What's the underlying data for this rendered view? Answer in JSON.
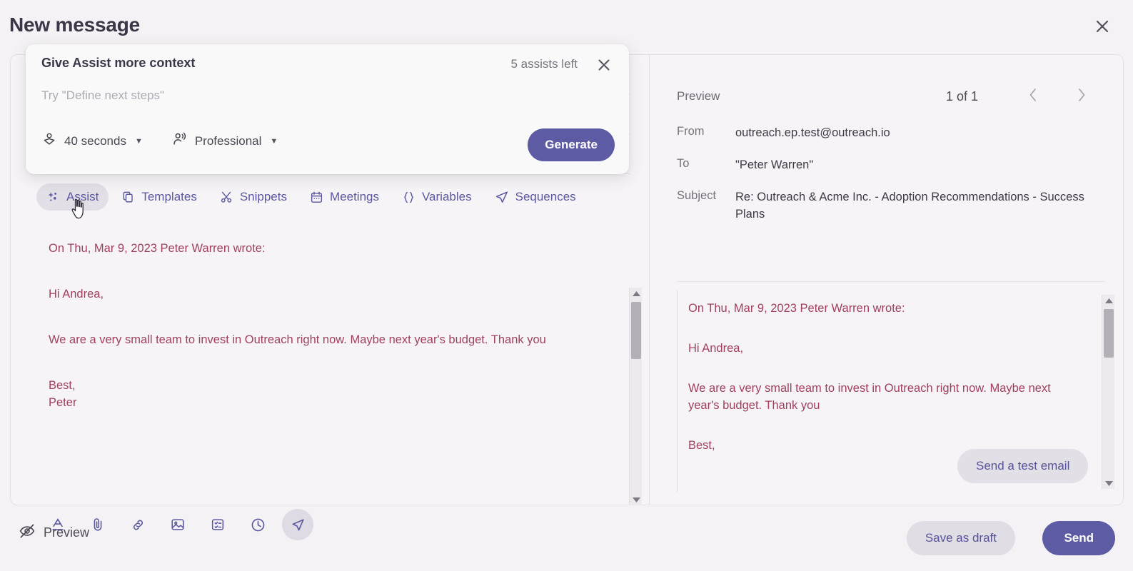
{
  "header": {
    "title": "New message",
    "close_icon": "close-icon"
  },
  "assist_popup": {
    "title": "Give Assist more context",
    "assists_left": "5 assists left",
    "close_icon": "close-icon",
    "input_placeholder": "Try \"Define next steps\"",
    "input_value": "",
    "duration_select": {
      "icon": "reading-time-icon",
      "value": "40 seconds",
      "caret": "▼"
    },
    "tone_select": {
      "icon": "tone-of-voice-icon",
      "value": "Professional",
      "caret": "▼"
    },
    "generate_label": "Generate"
  },
  "tabs": [
    {
      "label": "Assist",
      "icon": "sparkle-icon",
      "active": true
    },
    {
      "label": "Templates",
      "icon": "copy-icon",
      "active": false
    },
    {
      "label": "Snippets",
      "icon": "scissors-icon",
      "active": false
    },
    {
      "label": "Meetings",
      "icon": "calendar-icon",
      "active": false
    },
    {
      "label": "Variables",
      "icon": "braces-icon",
      "active": false
    },
    {
      "label": "Sequences",
      "icon": "paper-plane-icon",
      "active": false
    }
  ],
  "editor": {
    "body_paragraphs": [
      "On Thu, Mar 9, 2023 Peter Warren wrote:",
      "Hi Andrea,",
      "We are a very small team to invest in Outreach right now. Maybe next year's budget. Thank you",
      "Best,",
      "Peter"
    ],
    "toolbar_icons": [
      {
        "name": "text-format-icon",
        "active": false
      },
      {
        "name": "attachment-icon",
        "active": false
      },
      {
        "name": "link-icon",
        "active": false
      },
      {
        "name": "image-icon",
        "active": false
      },
      {
        "name": "template-icon",
        "active": false
      },
      {
        "name": "clock-icon",
        "active": false
      },
      {
        "name": "send-later-icon",
        "active": true
      }
    ]
  },
  "preview": {
    "label": "Preview",
    "counter": "1 of 1",
    "prev_icon": "chevron-left-icon",
    "next_icon": "chevron-right-icon",
    "fields": [
      {
        "label": "From",
        "value": "outreach.ep.test@outreach.io"
      },
      {
        "label": "To",
        "value": "\"Peter Warren\""
      },
      {
        "label": "Subject",
        "value": "Re: Outreach & Acme Inc. - Adoption Recommendations - Success Plans"
      }
    ],
    "body_paragraphs": [
      "On Thu, Mar 9, 2023 Peter Warren wrote:",
      "Hi Andrea,",
      "We are a very small team to invest in Outreach right now. Maybe next year's budget. Thank you",
      "Best,"
    ],
    "send_test_email_label": "Send a test email"
  },
  "bottom_bar": {
    "preview_toggle_label": "Preview",
    "preview_toggle_icon": "eye-off-icon",
    "save_draft_label": "Save as draft",
    "send_label": "Send"
  },
  "colors": {
    "accent_purple": "#5d5ba3",
    "quote_text": "#a0405f",
    "page_background": "#f4f2f4",
    "card_background": "#f6f4f6",
    "popup_background": "#faf9fa"
  }
}
